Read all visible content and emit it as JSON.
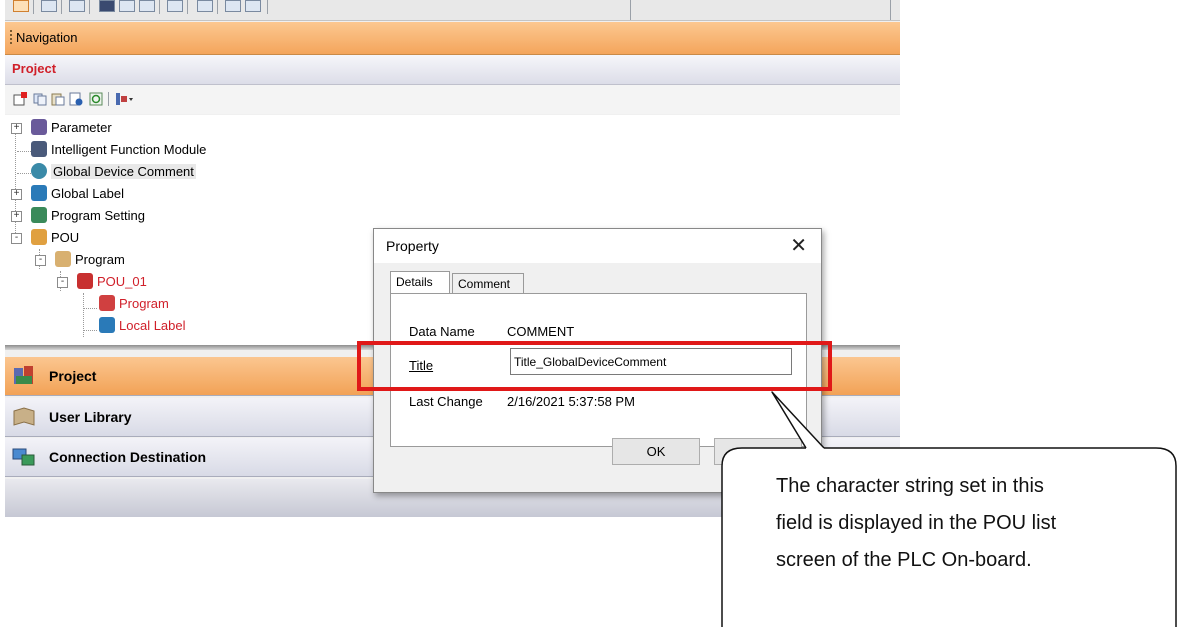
{
  "navigation": {
    "title": "Navigation",
    "project_strip_label": "Project"
  },
  "tree": [
    {
      "label": "Parameter",
      "expander": "+",
      "red": false
    },
    {
      "label": "Intelligent Function Module",
      "expander": "",
      "red": false
    },
    {
      "label": "Global Device Comment",
      "expander": "",
      "red": false,
      "selected": true
    },
    {
      "label": "Global Label",
      "expander": "+",
      "red": false
    },
    {
      "label": "Program Setting",
      "expander": "+",
      "red": false
    },
    {
      "label": "POU",
      "expander": "-",
      "red": false
    },
    {
      "label": "Program",
      "expander": "-",
      "red": false
    },
    {
      "label": "POU_01",
      "expander": "-",
      "red": true
    },
    {
      "label": "Program",
      "expander": "",
      "red": true
    },
    {
      "label": "Local Label",
      "expander": "",
      "red": true
    }
  ],
  "nav_bars": {
    "project": "Project",
    "user_library": "User Library",
    "connection_destination": "Connection Destination"
  },
  "dialog": {
    "title": "Property",
    "close_glyph": "✕",
    "tabs": {
      "details": "Details",
      "comment": "Comment"
    },
    "data_name_label": "Data Name",
    "data_name_value": "COMMENT",
    "title_label": "Title",
    "title_value": "Title_GlobalDeviceComment",
    "last_change_label": "Last Change",
    "last_change_value": "2/16/2021 5:37:58 PM",
    "ok_label": "OK",
    "cancel_label": ""
  },
  "callout": {
    "line1": "The character string set in this",
    "line2": "field is displayed in the POU list",
    "line3": "screen of the PLC On-board."
  },
  "colors": {
    "accent_orange": "#f4a55c",
    "highlight_red": "#e01818",
    "tree_red": "#d0202a"
  }
}
